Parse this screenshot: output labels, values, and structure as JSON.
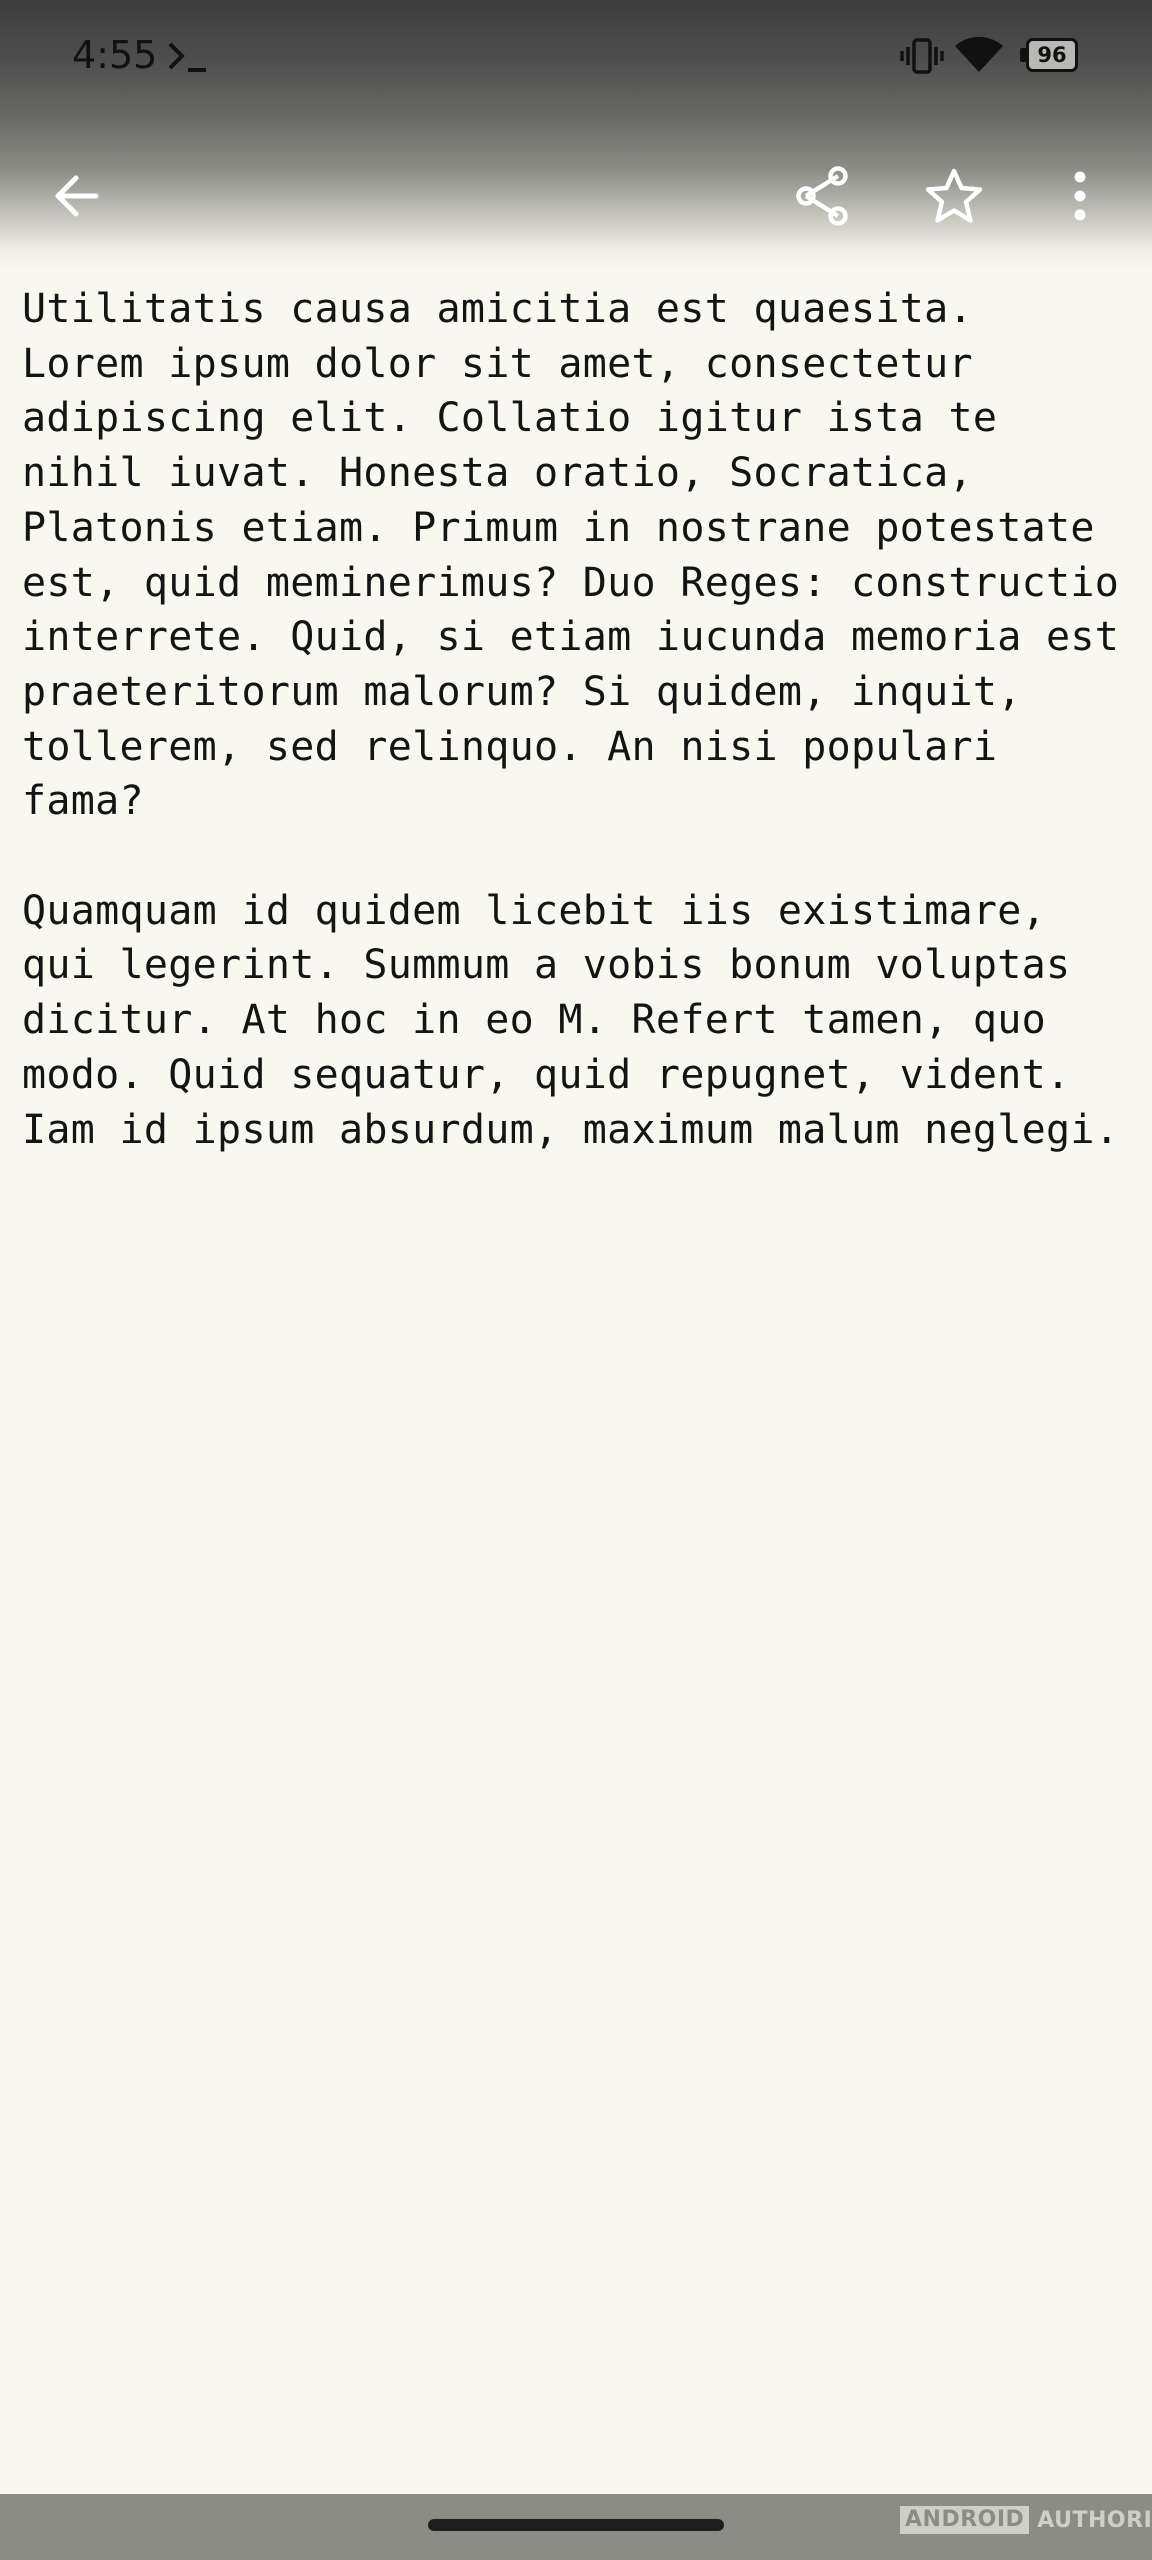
{
  "status_bar": {
    "time": "4:55",
    "battery_level": "96",
    "icons": [
      "terminal-icon",
      "vibrate-icon",
      "wifi-icon",
      "battery-icon"
    ]
  },
  "app_bar": {
    "icons": [
      "arrow-left-icon",
      "share-icon",
      "star-outline-icon",
      "more-vert-icon"
    ]
  },
  "content": {
    "paragraphs": [
      "Utilitatis causa amicitia est quaesita.\nLorem ipsum dolor sit amet, consectetur\nadipiscing elit. Collatio igitur ista te\nnihil iuvat. Honesta oratio, Socratica,\nPlatonis etiam. Primum in nostrane potestate\nest, quid meminerimus? Duo Reges: constructio\ninterrete. Quid, si etiam iucunda memoria est\npraeteritorum malorum? Si quidem, inquit,\ntollerem, sed relinquo. An nisi populari\nfama?",
      "Quamquam id quidem licebit iis existimare,\nqui legerint. Summum a vobis bonum voluptas\ndicitur. At hoc in eo M. Refert tamen, quo\nmodo. Quid sequatur, quid repugnet, vident.\nIam id ipsum absurdum, maximum malum neglegi."
    ]
  },
  "watermark": {
    "part1": "ANDROID",
    "part2": "AUTHORITY"
  },
  "colors": {
    "background": "#f8f8f1",
    "text": "#141414",
    "nav_bar": "#8c8c87"
  }
}
